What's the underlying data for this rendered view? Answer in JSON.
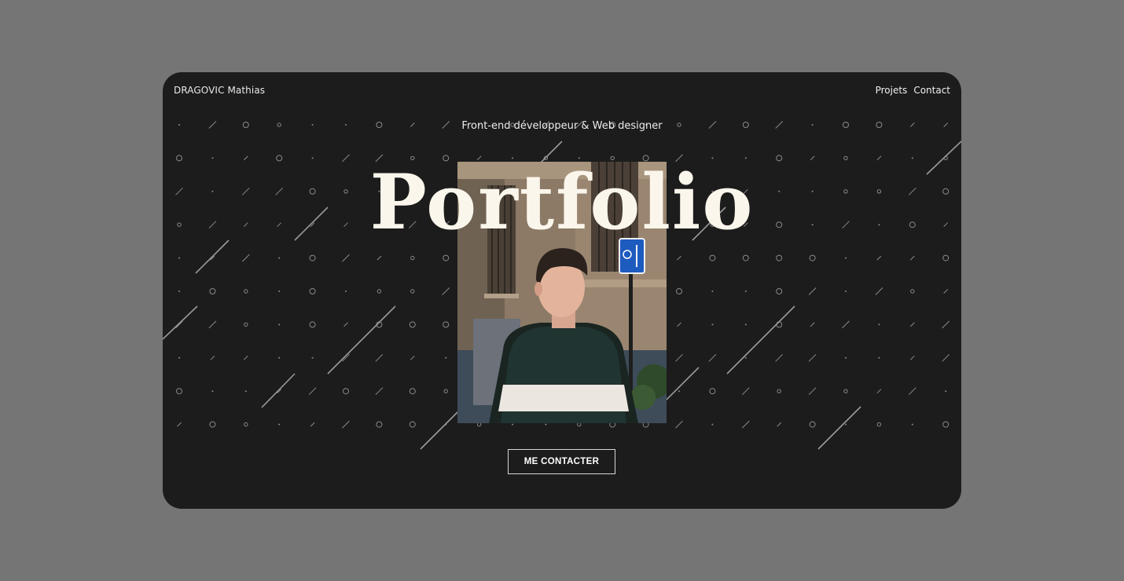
{
  "header": {
    "brand": "DRAGOVIC Mathias",
    "nav": [
      {
        "label": "Projets"
      },
      {
        "label": "Contact"
      }
    ]
  },
  "hero": {
    "subtitle": "Front-end développeur & Web designer",
    "title": "Portfolio",
    "cta_label": "ME CONTACTER"
  },
  "colors": {
    "page_background": "#757575",
    "card_background": "#1c1c1c",
    "title_color": "#fbf6ec",
    "pattern_color": "#8a8a8a"
  },
  "images": {
    "portrait": "photo of a young man in a dark sweater with a white stripe, standing in front of a stone building with a blue bike-lane sign"
  }
}
